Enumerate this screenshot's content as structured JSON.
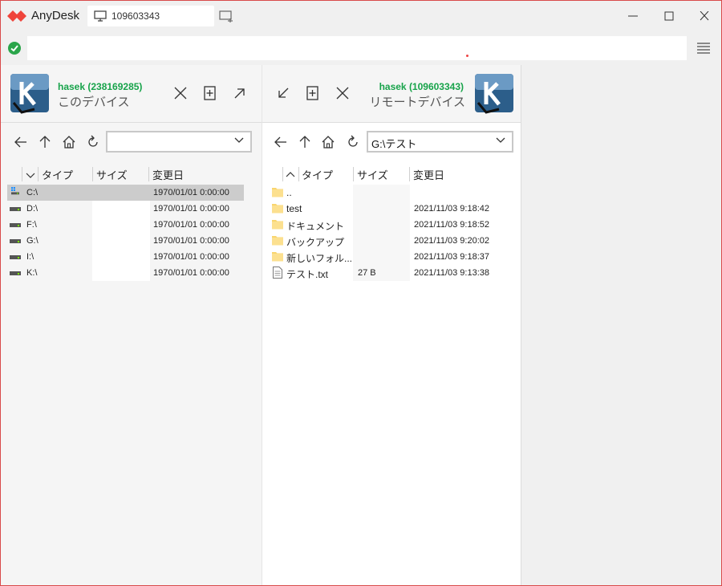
{
  "app": {
    "title": "AnyDesk",
    "brand_color": "#ef443b"
  },
  "tab": {
    "label": "109603343",
    "icon": "monitor-icon"
  },
  "address_bar": {
    "value": "",
    "status_icon": "check-circle-icon",
    "status_color": "#2aa54a"
  },
  "left_panel": {
    "user_name": "hasek (238169285)",
    "device_label": "このデバイス",
    "path": "",
    "columns": {
      "type": "タイプ",
      "size": "サイズ",
      "modified": "変更日"
    },
    "rows": [
      {
        "name": "C:\\",
        "size": "",
        "modified": "1970/01/01 0:00:00",
        "icon": "windows-drive-icon",
        "selected": true
      },
      {
        "name": "D:\\",
        "size": "",
        "modified": "1970/01/01 0:00:00",
        "icon": "drive-icon"
      },
      {
        "name": "F:\\",
        "size": "",
        "modified": "1970/01/01 0:00:00",
        "icon": "drive-icon"
      },
      {
        "name": "G:\\",
        "size": "",
        "modified": "1970/01/01 0:00:00",
        "icon": "drive-icon"
      },
      {
        "name": "I:\\",
        "size": "",
        "modified": "1970/01/01 0:00:00",
        "icon": "drive-icon"
      },
      {
        "name": "K:\\",
        "size": "",
        "modified": "1970/01/01 0:00:00",
        "icon": "drive-icon"
      }
    ]
  },
  "right_panel": {
    "user_name": "hasek (109603343)",
    "device_label": "リモートデバイス",
    "path": "G:\\テスト",
    "columns": {
      "type": "タイプ",
      "size": "サイズ",
      "modified": "変更日"
    },
    "rows": [
      {
        "name": "..",
        "size": "",
        "modified": "",
        "icon": "folder-icon"
      },
      {
        "name": "test",
        "size": "",
        "modified": "2021/11/03 9:18:42",
        "icon": "folder-icon"
      },
      {
        "name": "ドキュメント",
        "size": "",
        "modified": "2021/11/03 9:18:52",
        "icon": "folder-icon"
      },
      {
        "name": "バックアップ",
        "size": "",
        "modified": "2021/11/03 9:20:02",
        "icon": "folder-icon"
      },
      {
        "name": "新しいフォル...",
        "size": "",
        "modified": "2021/11/03 9:18:37",
        "icon": "folder-icon"
      },
      {
        "name": "テスト.txt",
        "size": "27 B",
        "modified": "2021/11/03 9:13:38",
        "icon": "text-file-icon"
      }
    ]
  }
}
